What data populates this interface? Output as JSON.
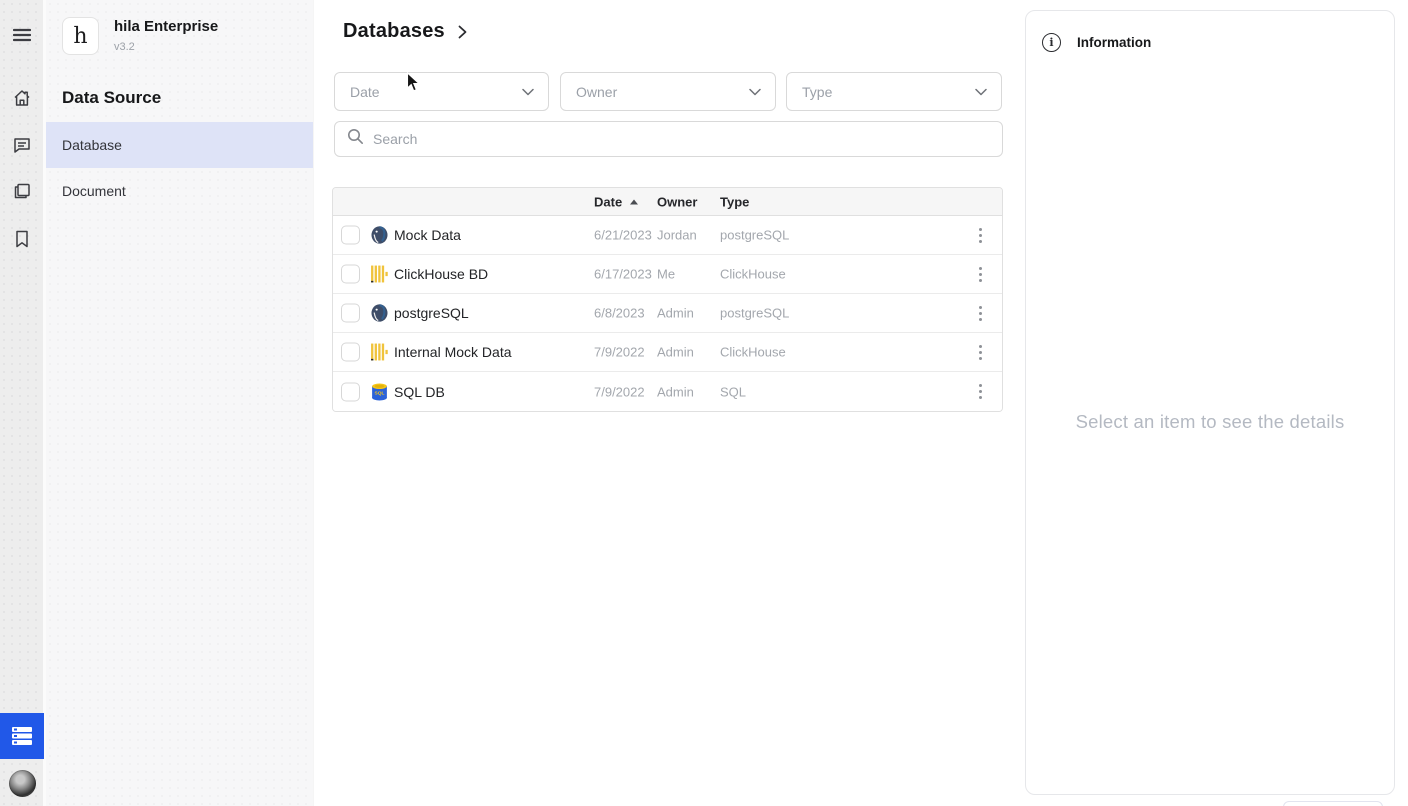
{
  "app": {
    "name": "hila Enterprise",
    "version": "v3.2",
    "logo_letter": "h"
  },
  "rail": {
    "icons": [
      "menu-icon",
      "home-icon",
      "chat-icon",
      "copy-icon",
      "bookmark-icon"
    ],
    "active_tool": "data-list-button",
    "has_avatar": true
  },
  "sidebar": {
    "heading": "Data Source",
    "items": [
      {
        "label": "Database",
        "selected": true
      },
      {
        "label": "Document",
        "selected": false
      }
    ]
  },
  "main": {
    "title": "Databases",
    "filters": [
      {
        "label": "Date"
      },
      {
        "label": "Owner"
      },
      {
        "label": "Type"
      }
    ],
    "search": {
      "placeholder": "Search"
    },
    "table": {
      "columns": {
        "date": "Date",
        "owner": "Owner",
        "type": "Type"
      },
      "sort": {
        "column": "Date",
        "direction": "asc"
      },
      "rows": [
        {
          "name": "Mock Data",
          "icon": "postgresql-icon",
          "date": "6/21/2023",
          "owner": "Jordan",
          "type": "postgreSQL"
        },
        {
          "name": "ClickHouse BD",
          "icon": "clickhouse-icon",
          "date": "6/17/2023",
          "owner": "Me",
          "type": "ClickHouse"
        },
        {
          "name": "postgreSQL",
          "icon": "postgresql-icon",
          "date": "6/8/2023",
          "owner": "Admin",
          "type": "postgreSQL"
        },
        {
          "name": "Internal Mock Data",
          "icon": "clickhouse-icon",
          "date": "7/9/2022",
          "owner": "Admin",
          "type": "ClickHouse"
        },
        {
          "name": "SQL DB",
          "icon": "sql-icon",
          "date": "7/9/2022",
          "owner": "Admin",
          "type": "SQL"
        }
      ]
    }
  },
  "info_panel": {
    "title": "Information",
    "empty_message": "Select an item to see the details"
  },
  "colors": {
    "accent_blue": "#2158e8",
    "selected_item_bg": "#dee3f7",
    "rail_bg": "#ededed",
    "sidebar_bg": "#f7f7f8",
    "table_header_bg": "#f6f6f6",
    "muted_text": "#a3a7ad",
    "postgres_blue": "#33608f",
    "clickhouse_yellow": "#f0c33c",
    "sql_yellow": "#f5c518"
  }
}
